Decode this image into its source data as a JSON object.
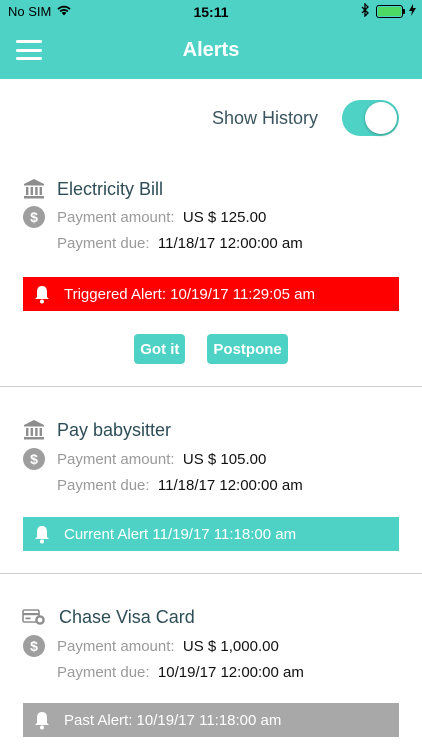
{
  "status_bar": {
    "carrier": "No SIM",
    "time": "15:11"
  },
  "header": {
    "title": "Alerts"
  },
  "history": {
    "label": "Show History",
    "enabled": true
  },
  "colors": {
    "accent": "#4ed2c6",
    "triggered": "#ff0000",
    "current": "#4ed2c6",
    "past": "#a8a8a8"
  },
  "labels": {
    "payment_amount": "Payment amount:",
    "payment_due": "Payment due:"
  },
  "alerts": [
    {
      "icon": "bank-icon",
      "title": "Electricity Bill",
      "amount": "US $ 125.00",
      "due": "11/18/17 12:00:00 am",
      "alert_text": "Triggered Alert:  10/19/17 11:29:05 am",
      "status": "triggered",
      "actions": [
        "Got it",
        "Postpone"
      ]
    },
    {
      "icon": "bank-icon",
      "title": "Pay babysitter",
      "amount": "US $ 105.00",
      "due": "11/18/17 12:00:00 am",
      "alert_text": "Current Alert  11/19/17 11:18:00 am",
      "status": "current"
    },
    {
      "icon": "credit-card-icon",
      "title": "Chase Visa Card",
      "amount": "US $ 1,000.00",
      "due": "10/19/17 12:00:00 am",
      "alert_text": "Past Alert:  10/19/17 11:18:00 am",
      "status": "past"
    }
  ]
}
